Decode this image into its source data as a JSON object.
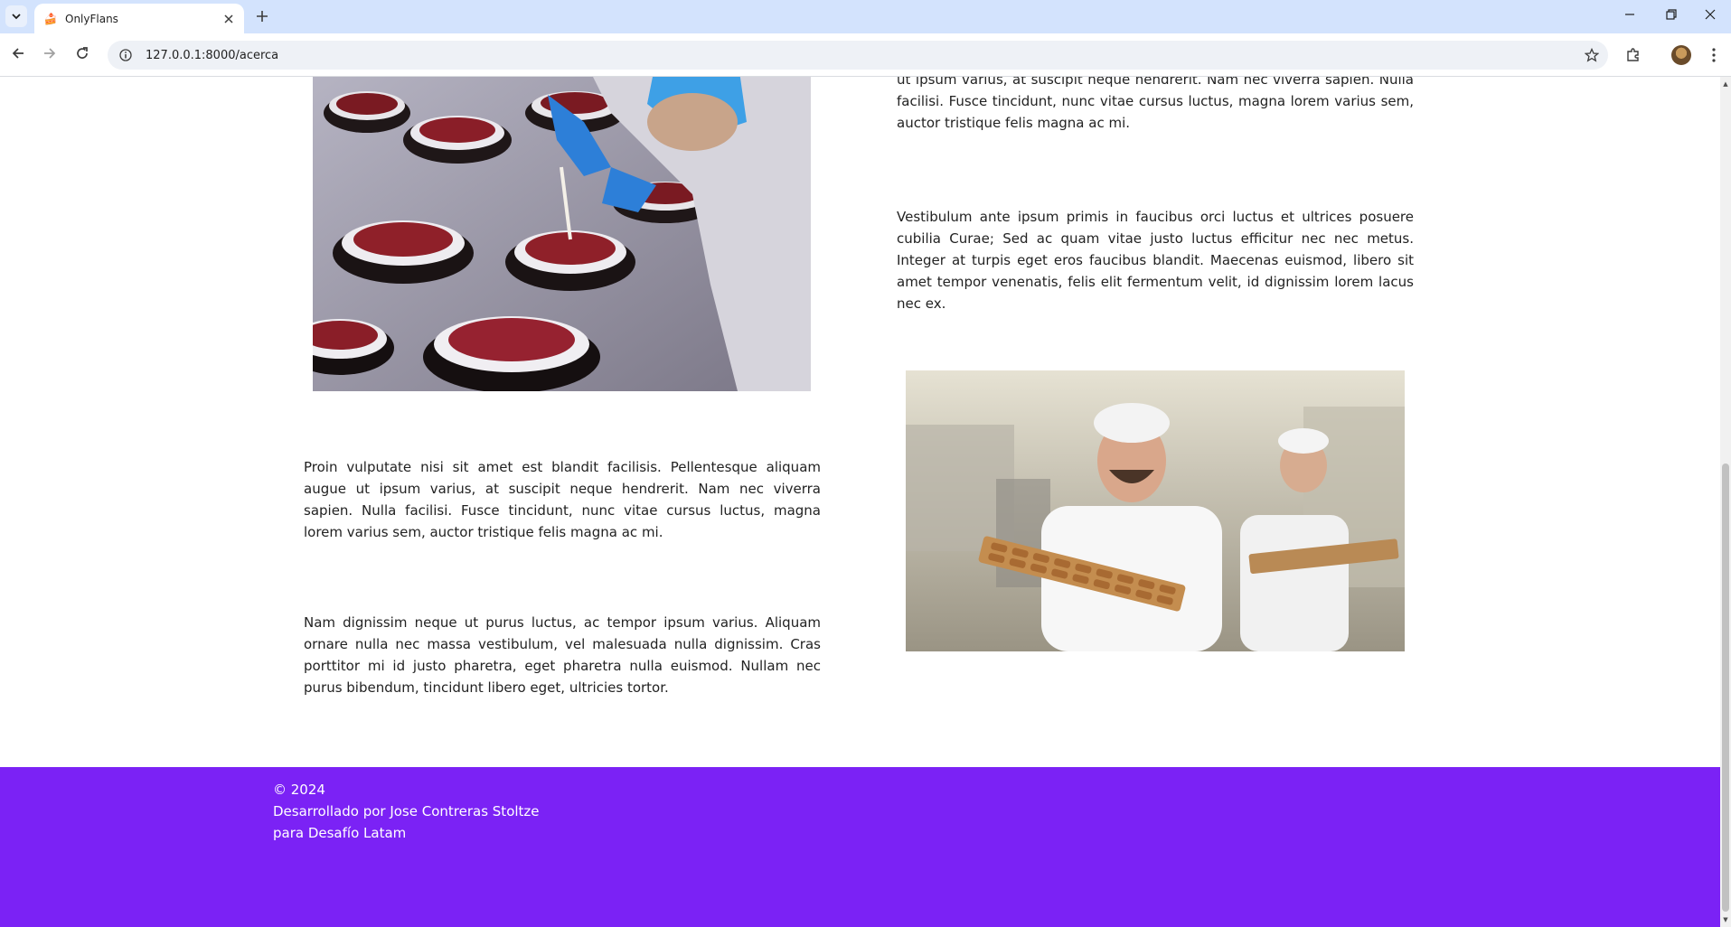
{
  "browser": {
    "tab_title": "OnlyFlans",
    "tab_favicon": "🍰",
    "url": "127.0.0.1:8000/acerca",
    "icons": {
      "tab_search": "chevron-down-icon",
      "close_tab": "close-icon",
      "new_tab": "plus-icon",
      "back": "arrow-left-icon",
      "forward": "arrow-right-icon",
      "reload": "reload-icon",
      "site_info": "info-icon",
      "bookmark": "star-icon",
      "extensions": "puzzle-icon",
      "menu": "more-vertical-icon"
    }
  },
  "content": {
    "para_top_right": "ut ipsum varius, at suscipit neque hendrerit. Nam nec viverra sapien. Nulla facilisi. Fusce tincidunt, nunc vitae cursus luctus, magna lorem varius sem, auctor tristique felis magna ac mi.",
    "para_right_2": "Vestibulum ante ipsum primis in faucibus orci luctus et ultrices posuere cubilia Curae; Sed ac quam vitae justo luctus efficitur nec nec metus. Integer at turpis eget eros faucibus blandit. Maecenas euismod, libero sit amet tempor venenatis, felis elit fermentum velit, id dignissim lorem lacus nec ex.",
    "para_left_1": "Proin vulputate nisi sit amet est blandit facilisis. Pellentesque aliquam augue ut ipsum varius, at suscipit neque hendrerit. Nam nec viverra sapien. Nulla facilisi. Fusce tincidunt, nunc vitae cursus luctus, magna lorem varius sem, auctor tristique felis magna ac mi.",
    "para_left_2": "Nam dignissim neque ut purus luctus, ac tempor ipsum varius. Aliquam ornare nulla nec massa vestibulum, vel malesuada nulla dignissim. Cras porttitor mi id justo pharetra, eget pharetra nulla euismod. Nullam nec purus bibendum, tincidunt libero eget, ultricies tortor."
  },
  "footer": {
    "copyright": "© 2024",
    "developer": "Desarrollado por Jose Contreras Stoltze",
    "for": "para Desafío Latam",
    "background": "#7b22f5"
  }
}
